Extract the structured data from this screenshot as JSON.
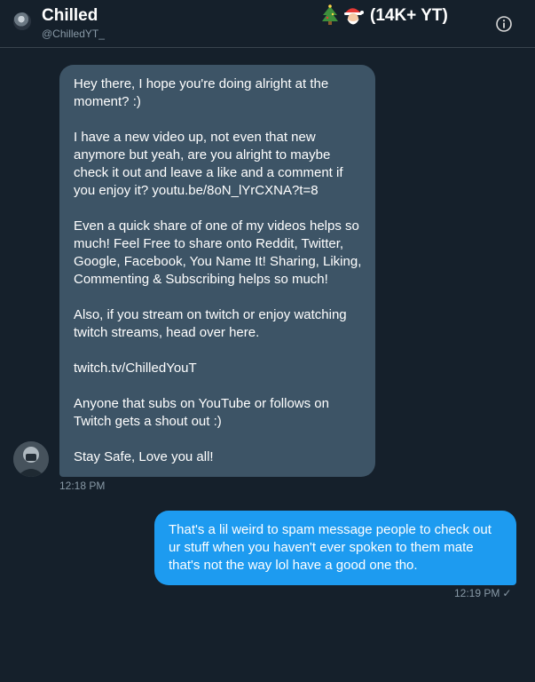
{
  "header": {
    "name": "Chilled",
    "name_suffix": "(14K+ YT)",
    "handle": "@ChilledYT_",
    "emoji": [
      "christmas-tree",
      "santa"
    ]
  },
  "received_message": {
    "paragraphs": [
      "Hey there, I hope you're doing alright at the moment? :)",
      "I have a new video up, not even that new anymore but yeah, are you alright to maybe check it out and leave a like and a comment if you enjoy it? youtu.be/8oN_lYrCXNA?t=8",
      "Even a quick share of one of my videos helps so much! Feel Free to share onto Reddit, Twitter, Google, Facebook, You Name It! Sharing, Liking, Commenting & Subscribing helps so much!",
      "Also, if you stream on twitch or enjoy watching twitch streams, head over here.",
      "twitch.tv/ChilledYouT",
      "Anyone that subs on YouTube or follows on Twitch gets a shout out :)",
      "Stay Safe, Love you all!"
    ],
    "time": "12:18 PM"
  },
  "sent_message": {
    "text": "That's a lil weird to spam message people to check out ur stuff when you haven't ever spoken to them mate that's not the way lol have a good one tho.",
    "time": "12:19 PM",
    "status_icon": "checkmark"
  },
  "colors": {
    "background": "#15202b",
    "received_bubble": "#3d5466",
    "sent_bubble": "#1d9bf0",
    "muted_text": "#8899a6",
    "divider": "#38444d"
  }
}
